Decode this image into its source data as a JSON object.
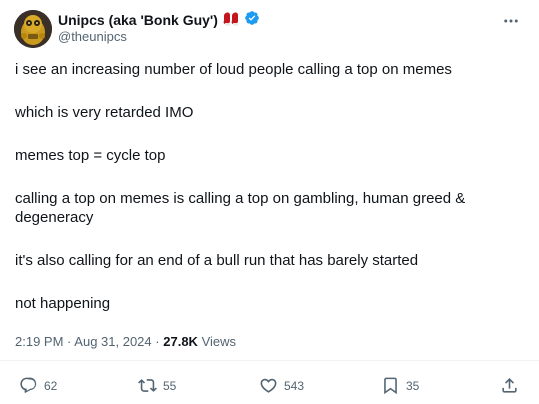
{
  "author": {
    "display_name": "Unipcs (aka 'Bonk Guy')",
    "handle": "@theunipcs",
    "verified": true,
    "emoji_icon": "boxing-gloves-icon"
  },
  "tweet": {
    "paragraphs": [
      "i see an increasing number of loud people calling a top on memes",
      "which is very retarded IMO",
      "memes top = cycle top",
      "calling a top on memes is calling a top on gambling, human greed & degeneracy",
      "it's also calling for an end of a bull run that has barely started",
      "not happening"
    ],
    "time": "2:19 PM",
    "separator": "·",
    "date": "Aug 31, 2024",
    "views_count": "27.8K",
    "views_label": "Views"
  },
  "actions": {
    "replies": "62",
    "reposts": "55",
    "likes": "543",
    "bookmarks": "35"
  },
  "colors": {
    "text": "#0f1419",
    "secondary": "#536471",
    "verified": "#1d9bf0",
    "divider": "#eff3f4",
    "emoji": "#c4161c"
  }
}
